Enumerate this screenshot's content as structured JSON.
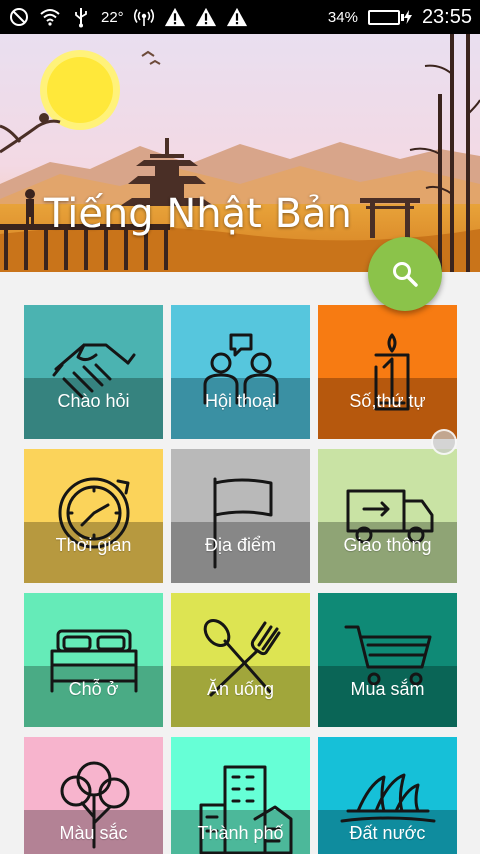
{
  "status_bar": {
    "temperature": "22°",
    "battery_percent": "34%",
    "battery_level": 0.34,
    "time": "23:55",
    "icons": [
      "no-sim-icon",
      "wifi-icon",
      "usb-icon",
      "hotspot-icon",
      "warning-icon",
      "warning-icon",
      "warning-icon",
      "charging-icon"
    ]
  },
  "header": {
    "title": "Tiếng Nhật Bản",
    "search_icon": "search-icon"
  },
  "colors": {
    "fab": "#8bc34a",
    "status_bar": "#000000"
  },
  "categories": [
    {
      "label": "Chào hỏi",
      "icon": "handshake-icon",
      "top": "#4bb3b1",
      "bottom": "#36837f"
    },
    {
      "label": "Hội thoại",
      "icon": "conversation-icon",
      "top": "#56c6dd",
      "bottom": "#3a90a3"
    },
    {
      "label": "Số,thứ tự",
      "icon": "number-one-icon",
      "top": "#f77b12",
      "bottom": "#b6580d"
    },
    {
      "label": "Thời gian",
      "icon": "clock-icon",
      "top": "#fbd35a",
      "bottom": "#b7993f"
    },
    {
      "label": "Địa điểm",
      "icon": "flag-icon",
      "top": "#b9b9b9",
      "bottom": "#878787"
    },
    {
      "label": "Giao thông",
      "icon": "truck-icon",
      "top": "#c9e3a4",
      "bottom": "#8fa475"
    },
    {
      "label": "Chỗ ở",
      "icon": "bed-icon",
      "top": "#65ebb8",
      "bottom": "#4aab85"
    },
    {
      "label": "Ăn uống",
      "icon": "fork-spoon-icon",
      "top": "#dde452",
      "bottom": "#a1a63b"
    },
    {
      "label": "Mua sắm",
      "icon": "shopping-cart-icon",
      "top": "#0f8a76",
      "bottom": "#0a6556"
    },
    {
      "label": "Màu sắc",
      "icon": "tree-icon",
      "top": "#f7b4cd",
      "bottom": "#b38295"
    },
    {
      "label": "Thành phố",
      "icon": "buildings-icon",
      "top": "#66ffd6",
      "bottom": "#4cb89a"
    },
    {
      "label": "Đất nước",
      "icon": "opera-house-icon",
      "top": "#16c0d8",
      "bottom": "#0f8c9e"
    }
  ]
}
